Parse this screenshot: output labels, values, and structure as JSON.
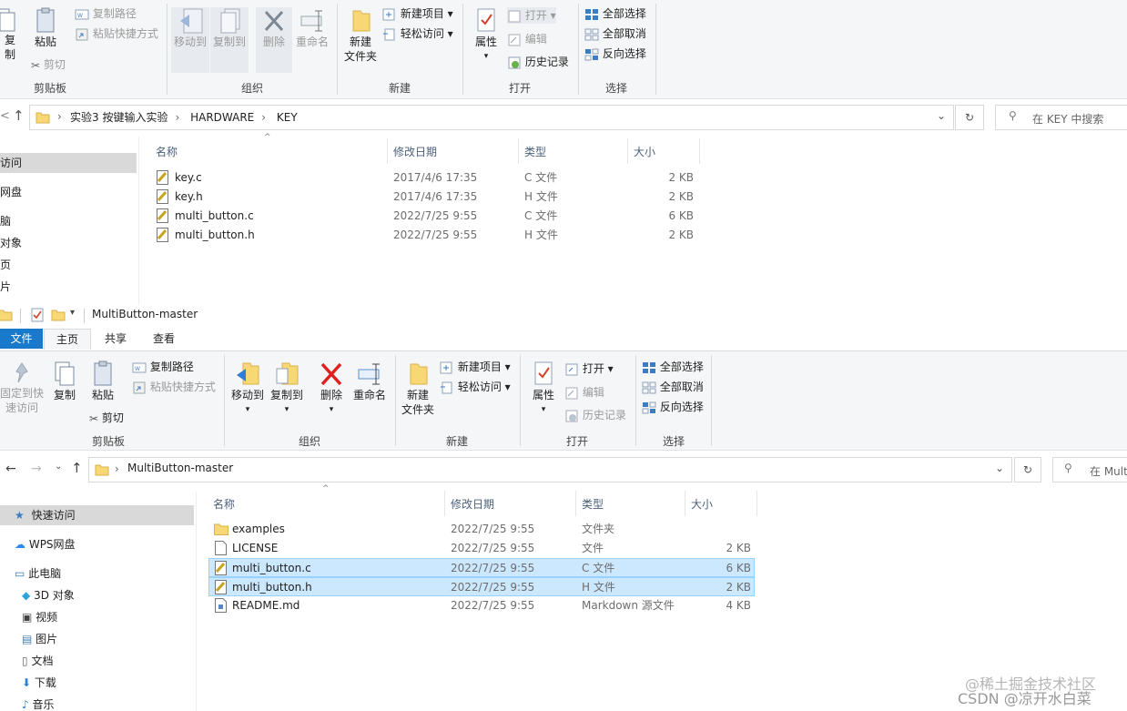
{
  "top": {
    "ribbon": {
      "copy": "复制",
      "paste": "粘贴",
      "copy_path": "复制路径",
      "paste_shortcut": "粘贴快捷方式",
      "cut": "剪切",
      "clipboard": "剪贴板",
      "move_to": "移动到",
      "copy_to": "复制到",
      "delete": "删除",
      "rename": "重命名",
      "organize": "组织",
      "new_folder": "新建",
      "new_folder2": "文件夹",
      "new_item": "新建项目",
      "easy_access": "轻松访问",
      "new": "新建",
      "properties": "属性",
      "open": "打开",
      "edit": "编辑",
      "history": "历史记录",
      "open_group": "打开",
      "select_all": "全部选择",
      "select_none": "全部取消",
      "invert": "反向选择",
      "select_group": "选择"
    },
    "path": [
      "实验3 按键输入实验",
      "HARDWARE",
      "KEY"
    ],
    "search_placeholder": "在 KEY 中搜索",
    "columns": [
      "名称",
      "修改日期",
      "类型",
      "大小"
    ],
    "nav": [
      "访问",
      "网盘",
      "脑",
      "对象",
      "页",
      "片"
    ],
    "files": [
      {
        "name": "key.c",
        "date": "2017/4/6 17:35",
        "type": "C 文件",
        "size": "2 KB"
      },
      {
        "name": "key.h",
        "date": "2017/4/6 17:35",
        "type": "H 文件",
        "size": "2 KB"
      },
      {
        "name": "multi_button.c",
        "date": "2022/7/25 9:55",
        "type": "C 文件",
        "size": "6 KB"
      },
      {
        "name": "multi_button.h",
        "date": "2022/7/25 9:55",
        "type": "H 文件",
        "size": "2 KB"
      }
    ]
  },
  "bottom": {
    "title": "MultiButton-master",
    "tabs": [
      "文件",
      "主页",
      "共享",
      "查看"
    ],
    "ribbon": {
      "pin": "固定到快",
      "pin2": "速访问",
      "copy": "复制",
      "paste": "粘贴",
      "copy_path": "复制路径",
      "paste_shortcut": "粘贴快捷方式",
      "cut": "剪切",
      "clipboard": "剪贴板",
      "move_to": "移动到",
      "copy_to": "复制到",
      "delete": "删除",
      "rename": "重命名",
      "organize": "组织",
      "new_folder": "新建",
      "new_folder2": "文件夹",
      "new_item": "新建项目",
      "easy_access": "轻松访问",
      "new": "新建",
      "properties": "属性",
      "open": "打开",
      "edit": "编辑",
      "history": "历史记录",
      "open_group": "打开",
      "select_all": "全部选择",
      "select_none": "全部取消",
      "invert": "反向选择",
      "select_group": "选择"
    },
    "path": [
      "MultiButton-master"
    ],
    "search_placeholder": "在 Mult",
    "columns": [
      "名称",
      "修改日期",
      "类型",
      "大小"
    ],
    "nav": [
      "快速访问",
      "WPS网盘",
      "此电脑",
      "3D 对象",
      "视频",
      "图片",
      "文档",
      "下载",
      "音乐"
    ],
    "files": [
      {
        "name": "examples",
        "date": "2022/7/25 9:55",
        "type": "文件夹",
        "size": "",
        "icon": "folder"
      },
      {
        "name": "LICENSE",
        "date": "2022/7/25 9:55",
        "type": "文件",
        "size": "2 KB",
        "icon": "file"
      },
      {
        "name": "multi_button.c",
        "date": "2022/7/25 9:55",
        "type": "C 文件",
        "size": "6 KB",
        "icon": "code"
      },
      {
        "name": "multi_button.h",
        "date": "2022/7/25 9:55",
        "type": "H 文件",
        "size": "2 KB",
        "icon": "code"
      },
      {
        "name": "README.md",
        "date": "2022/7/25 9:55",
        "type": "Markdown 源文件",
        "size": "4 KB",
        "icon": "md"
      }
    ]
  },
  "watermark": {
    "line1": "@稀土掘金技术社区",
    "line2": "CSDN @凉开水白菜"
  },
  "colors": {
    "accent": "#1979ca",
    "selection": "#cce8ff",
    "ribbon_bg": "#f5f6f7"
  }
}
